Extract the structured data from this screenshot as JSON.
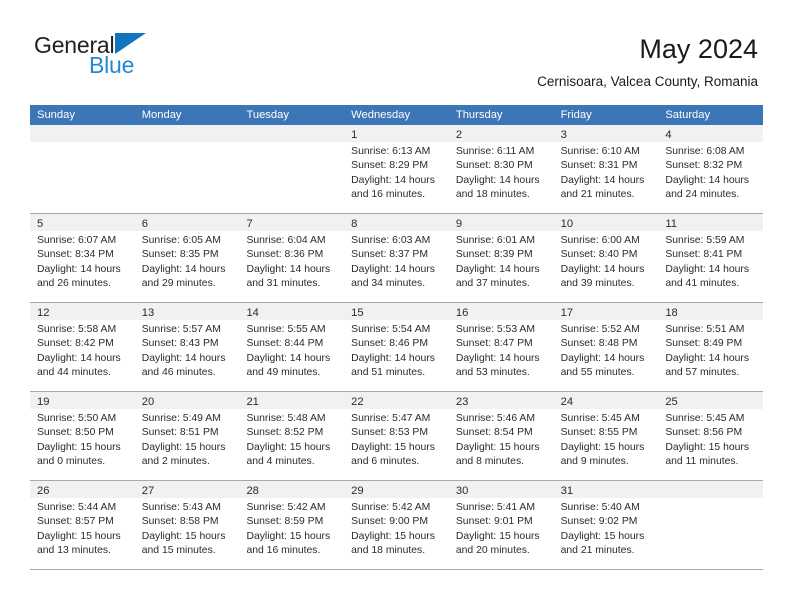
{
  "brand": {
    "name_part1": "General",
    "name_part2": "Blue",
    "triangle_color": "#1274bc",
    "blue_color": "#1e8ad6"
  },
  "header": {
    "title": "May 2024",
    "subtitle": "Cernisoara, Valcea County, Romania"
  },
  "theme": {
    "header_row_bg": "#3d76b6",
    "day_band_bg": "#f1f1f1",
    "grid_line": "#a9a9a9",
    "text": "#2b2b2b"
  },
  "calendar": {
    "month": "May",
    "year": "2024",
    "weekday_headers": [
      "Sunday",
      "Monday",
      "Tuesday",
      "Wednesday",
      "Thursday",
      "Friday",
      "Saturday"
    ],
    "weeks": [
      [
        {
          "day": "",
          "lines": []
        },
        {
          "day": "",
          "lines": []
        },
        {
          "day": "",
          "lines": []
        },
        {
          "day": "1",
          "lines": [
            "Sunrise: 6:13 AM",
            "Sunset: 8:29 PM",
            "Daylight: 14 hours",
            "and 16 minutes."
          ]
        },
        {
          "day": "2",
          "lines": [
            "Sunrise: 6:11 AM",
            "Sunset: 8:30 PM",
            "Daylight: 14 hours",
            "and 18 minutes."
          ]
        },
        {
          "day": "3",
          "lines": [
            "Sunrise: 6:10 AM",
            "Sunset: 8:31 PM",
            "Daylight: 14 hours",
            "and 21 minutes."
          ]
        },
        {
          "day": "4",
          "lines": [
            "Sunrise: 6:08 AM",
            "Sunset: 8:32 PM",
            "Daylight: 14 hours",
            "and 24 minutes."
          ]
        }
      ],
      [
        {
          "day": "5",
          "lines": [
            "Sunrise: 6:07 AM",
            "Sunset: 8:34 PM",
            "Daylight: 14 hours",
            "and 26 minutes."
          ]
        },
        {
          "day": "6",
          "lines": [
            "Sunrise: 6:05 AM",
            "Sunset: 8:35 PM",
            "Daylight: 14 hours",
            "and 29 minutes."
          ]
        },
        {
          "day": "7",
          "lines": [
            "Sunrise: 6:04 AM",
            "Sunset: 8:36 PM",
            "Daylight: 14 hours",
            "and 31 minutes."
          ]
        },
        {
          "day": "8",
          "lines": [
            "Sunrise: 6:03 AM",
            "Sunset: 8:37 PM",
            "Daylight: 14 hours",
            "and 34 minutes."
          ]
        },
        {
          "day": "9",
          "lines": [
            "Sunrise: 6:01 AM",
            "Sunset: 8:39 PM",
            "Daylight: 14 hours",
            "and 37 minutes."
          ]
        },
        {
          "day": "10",
          "lines": [
            "Sunrise: 6:00 AM",
            "Sunset: 8:40 PM",
            "Daylight: 14 hours",
            "and 39 minutes."
          ]
        },
        {
          "day": "11",
          "lines": [
            "Sunrise: 5:59 AM",
            "Sunset: 8:41 PM",
            "Daylight: 14 hours",
            "and 41 minutes."
          ]
        }
      ],
      [
        {
          "day": "12",
          "lines": [
            "Sunrise: 5:58 AM",
            "Sunset: 8:42 PM",
            "Daylight: 14 hours",
            "and 44 minutes."
          ]
        },
        {
          "day": "13",
          "lines": [
            "Sunrise: 5:57 AM",
            "Sunset: 8:43 PM",
            "Daylight: 14 hours",
            "and 46 minutes."
          ]
        },
        {
          "day": "14",
          "lines": [
            "Sunrise: 5:55 AM",
            "Sunset: 8:44 PM",
            "Daylight: 14 hours",
            "and 49 minutes."
          ]
        },
        {
          "day": "15",
          "lines": [
            "Sunrise: 5:54 AM",
            "Sunset: 8:46 PM",
            "Daylight: 14 hours",
            "and 51 minutes."
          ]
        },
        {
          "day": "16",
          "lines": [
            "Sunrise: 5:53 AM",
            "Sunset: 8:47 PM",
            "Daylight: 14 hours",
            "and 53 minutes."
          ]
        },
        {
          "day": "17",
          "lines": [
            "Sunrise: 5:52 AM",
            "Sunset: 8:48 PM",
            "Daylight: 14 hours",
            "and 55 minutes."
          ]
        },
        {
          "day": "18",
          "lines": [
            "Sunrise: 5:51 AM",
            "Sunset: 8:49 PM",
            "Daylight: 14 hours",
            "and 57 minutes."
          ]
        }
      ],
      [
        {
          "day": "19",
          "lines": [
            "Sunrise: 5:50 AM",
            "Sunset: 8:50 PM",
            "Daylight: 15 hours",
            "and 0 minutes."
          ]
        },
        {
          "day": "20",
          "lines": [
            "Sunrise: 5:49 AM",
            "Sunset: 8:51 PM",
            "Daylight: 15 hours",
            "and 2 minutes."
          ]
        },
        {
          "day": "21",
          "lines": [
            "Sunrise: 5:48 AM",
            "Sunset: 8:52 PM",
            "Daylight: 15 hours",
            "and 4 minutes."
          ]
        },
        {
          "day": "22",
          "lines": [
            "Sunrise: 5:47 AM",
            "Sunset: 8:53 PM",
            "Daylight: 15 hours",
            "and 6 minutes."
          ]
        },
        {
          "day": "23",
          "lines": [
            "Sunrise: 5:46 AM",
            "Sunset: 8:54 PM",
            "Daylight: 15 hours",
            "and 8 minutes."
          ]
        },
        {
          "day": "24",
          "lines": [
            "Sunrise: 5:45 AM",
            "Sunset: 8:55 PM",
            "Daylight: 15 hours",
            "and 9 minutes."
          ]
        },
        {
          "day": "25",
          "lines": [
            "Sunrise: 5:45 AM",
            "Sunset: 8:56 PM",
            "Daylight: 15 hours",
            "and 11 minutes."
          ]
        }
      ],
      [
        {
          "day": "26",
          "lines": [
            "Sunrise: 5:44 AM",
            "Sunset: 8:57 PM",
            "Daylight: 15 hours",
            "and 13 minutes."
          ]
        },
        {
          "day": "27",
          "lines": [
            "Sunrise: 5:43 AM",
            "Sunset: 8:58 PM",
            "Daylight: 15 hours",
            "and 15 minutes."
          ]
        },
        {
          "day": "28",
          "lines": [
            "Sunrise: 5:42 AM",
            "Sunset: 8:59 PM",
            "Daylight: 15 hours",
            "and 16 minutes."
          ]
        },
        {
          "day": "29",
          "lines": [
            "Sunrise: 5:42 AM",
            "Sunset: 9:00 PM",
            "Daylight: 15 hours",
            "and 18 minutes."
          ]
        },
        {
          "day": "30",
          "lines": [
            "Sunrise: 5:41 AM",
            "Sunset: 9:01 PM",
            "Daylight: 15 hours",
            "and 20 minutes."
          ]
        },
        {
          "day": "31",
          "lines": [
            "Sunrise: 5:40 AM",
            "Sunset: 9:02 PM",
            "Daylight: 15 hours",
            "and 21 minutes."
          ]
        },
        {
          "day": "",
          "lines": []
        }
      ]
    ]
  }
}
